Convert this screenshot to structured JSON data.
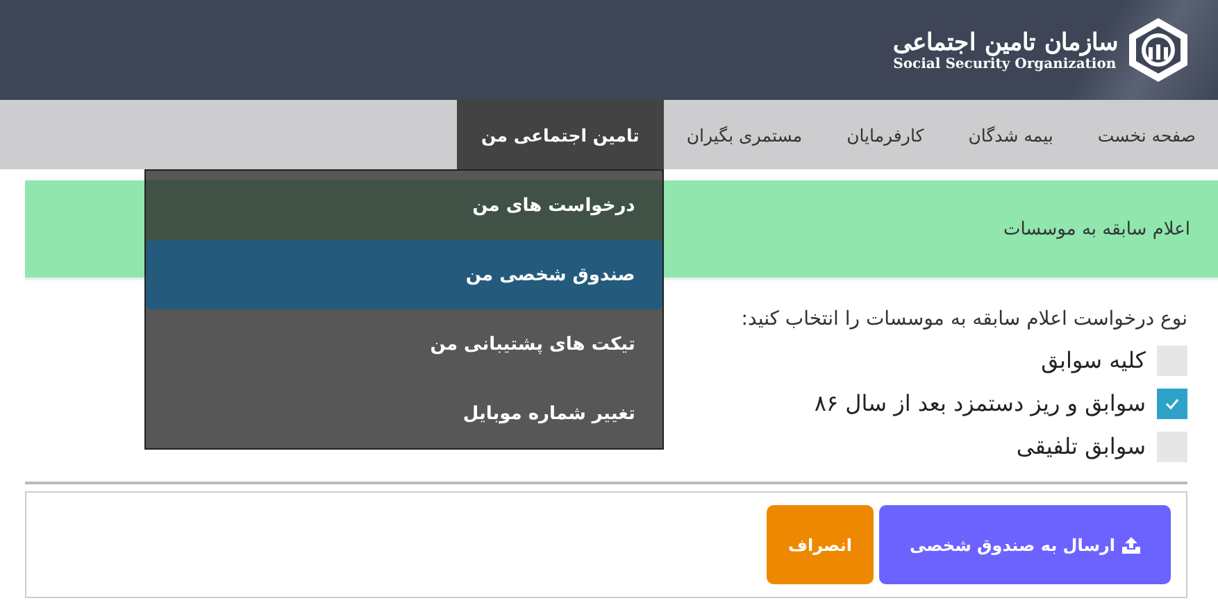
{
  "header": {
    "logo_title": "سازمان تامین اجتماعی",
    "logo_subtitle": "Social Security Organization"
  },
  "nav": [
    {
      "label": "صفحه نخست",
      "selected": false
    },
    {
      "label": "بیمه شدگان",
      "selected": false
    },
    {
      "label": "کارفرمایان",
      "selected": false
    },
    {
      "label": "مستمری بگیران",
      "selected": false
    },
    {
      "label": "تامین اجتماعی من",
      "selected": true
    }
  ],
  "dropdown": [
    {
      "label": "درخواست های من",
      "selected": false
    },
    {
      "label": "صندوق شخصی من",
      "selected": true
    },
    {
      "label": "تیکت های پشتیبانی من",
      "selected": false
    },
    {
      "label": "تغییر شماره موبایل",
      "selected": false
    }
  ],
  "banner": "اعلام سابقه به موسسات",
  "form": {
    "question": "نوع درخواست اعلام سابقه به موسسات را انتخاب کنید:",
    "options": [
      {
        "label": "کلیه سوابق",
        "checked": false
      },
      {
        "label": "سوابق و ریز دستمزد بعد از سال ۸۶",
        "checked": true
      },
      {
        "label": "سوابق تلفیقی",
        "checked": false
      }
    ]
  },
  "buttons": [
    {
      "kind": "primary",
      "label": "ارسال به صندوق شخصی"
    },
    {
      "kind": "cancel",
      "label": "انصراف"
    }
  ]
}
